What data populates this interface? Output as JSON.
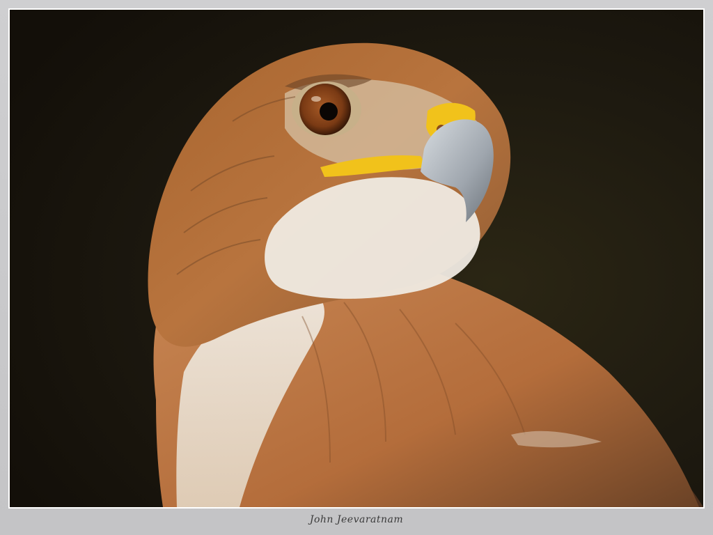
{
  "image": {
    "subject": "red-tailed-hawk",
    "background_color": "#1c1810",
    "colors": {
      "feather_rufous": "#b8743e",
      "feather_light": "#e9e3d8",
      "feather_dark": "#5a3a22",
      "beak_gray": "#a7aeb6",
      "cere_yellow": "#f1c21b",
      "eye_iris": "#7a3a14",
      "eye_pupil": "#0a0604"
    }
  },
  "footer": {
    "signature": "John Jeevaratnam"
  }
}
